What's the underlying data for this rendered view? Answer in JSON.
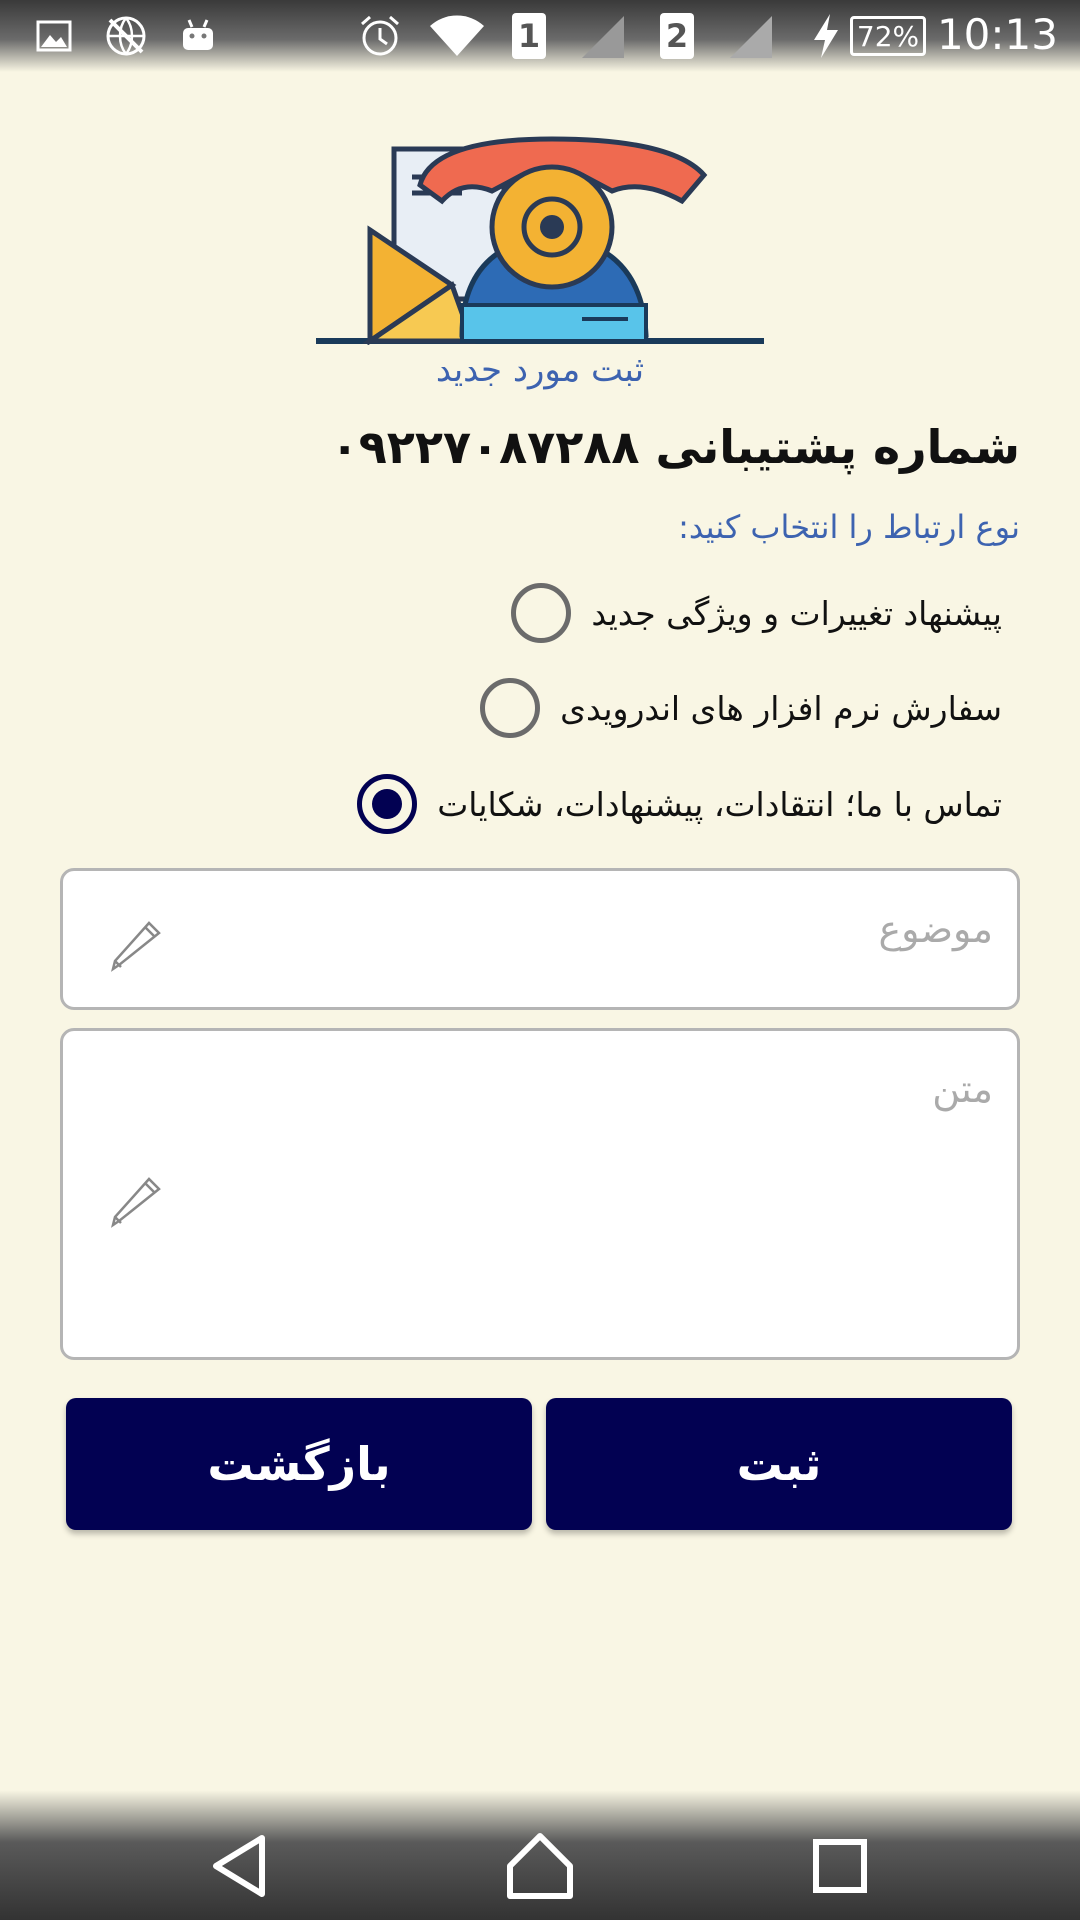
{
  "status_bar": {
    "time": "10:13",
    "battery": "72%",
    "sim1": "1",
    "sim2": "2",
    "icons": [
      "gallery-icon",
      "no-network-icon",
      "android-icon",
      "alarm-icon",
      "wifi-icon",
      "signal-icon",
      "charging-icon"
    ]
  },
  "header": {
    "title": "ثبت مورد جدید",
    "support_number": "شماره پشتیبانی ۰۹۲۲۷۰۸۷۲۸۸"
  },
  "form": {
    "choose_label": "نوع ارتباط را انتخاب کنید:",
    "options": [
      {
        "label": "پیشنهاد تغییرات و ویژگی جدید",
        "checked": false
      },
      {
        "label": "سفارش نرم افزار های اندرویدی",
        "checked": false
      },
      {
        "label": "تماس با ما؛ انتقادات، پیشنهادات، شکایات",
        "checked": true
      }
    ],
    "subject_placeholder": "موضوع",
    "body_placeholder": "متن",
    "submit_label": "ثبت",
    "back_label": "بازگشت"
  },
  "colors": {
    "background": "#f9f6e4",
    "accent_blue": "#3d63b0",
    "button_navy": "#020152"
  }
}
